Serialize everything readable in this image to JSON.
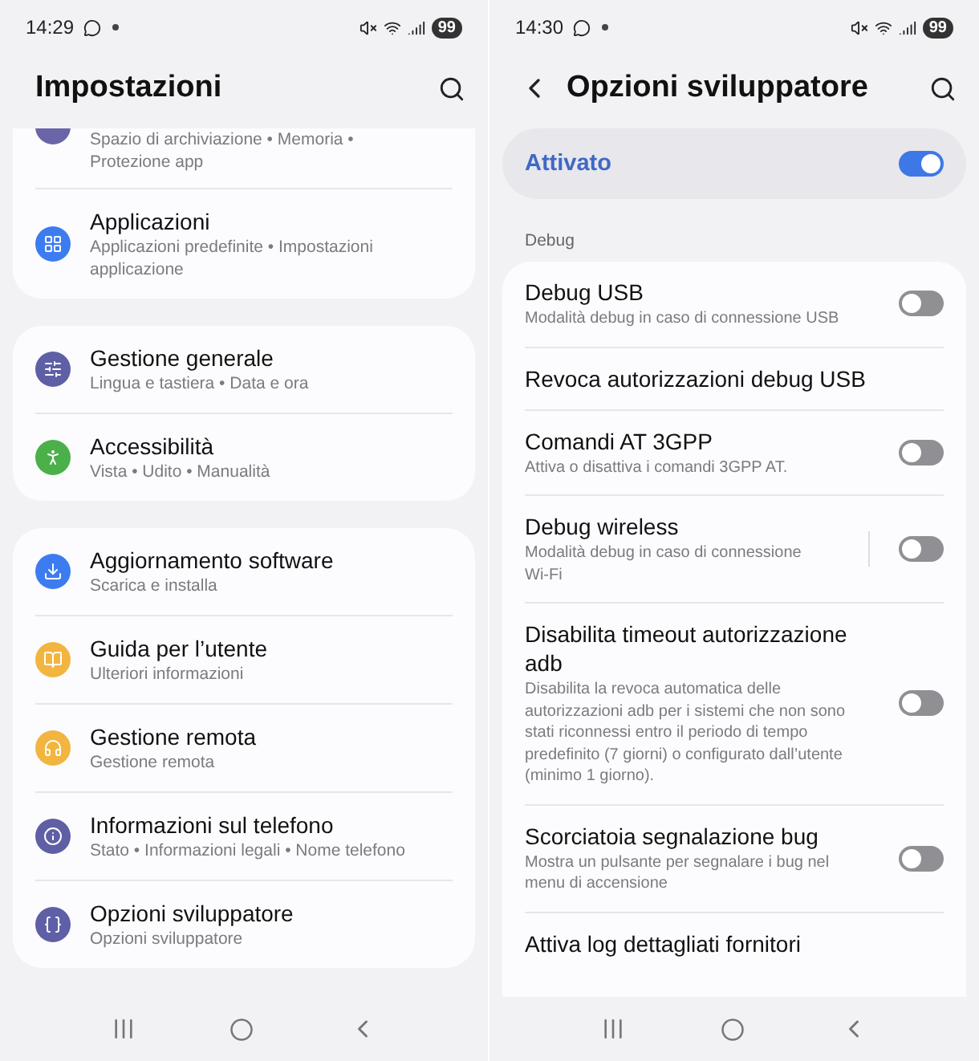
{
  "left": {
    "status_bar": {
      "time": "14:29",
      "battery": "99"
    },
    "title": "Impostazioni",
    "groups": [
      {
        "items": [
          {
            "subtitle": "Spazio di archiviazione • Memoria •",
            "subtitle2": "Protezione app",
            "color": "#6a64a8",
            "partial": true
          },
          {
            "title": "Applicazioni",
            "subtitle": "Applicazioni predefinite • Impostazioni applicazione",
            "color": "#3d7cf0"
          }
        ]
      },
      {
        "items": [
          {
            "title": "Gestione generale",
            "subtitle": "Lingua e tastiera • Data e ora",
            "color": "#5f5fa6"
          },
          {
            "title": "Accessibilità",
            "subtitle": "Vista • Udito • Manualità",
            "color": "#4bb04a"
          }
        ]
      },
      {
        "items": [
          {
            "title": "Aggiornamento software",
            "subtitle": "Scarica e installa",
            "color": "#3d7cf0"
          },
          {
            "title": "Guida per l’utente",
            "subtitle": "Ulteriori informazioni",
            "color": "#f2b540"
          },
          {
            "title": "Gestione remota",
            "subtitle": "Gestione remota",
            "color": "#f2b540"
          },
          {
            "title": "Informazioni sul telefono",
            "subtitle": "Stato • Informazioni legali • Nome telefono",
            "color": "#5f5fa6"
          },
          {
            "title": "Opzioni sviluppatore",
            "subtitle": "Opzioni sviluppatore",
            "color": "#5f5fa6"
          }
        ]
      }
    ]
  },
  "right": {
    "status_bar": {
      "time": "14:30",
      "battery": "99"
    },
    "title": "Opzioni sviluppatore",
    "master": {
      "label": "Attivato",
      "on": true
    },
    "section": "Debug",
    "rows": [
      {
        "kind": "toggle",
        "title": "Debug USB",
        "subtitle": "Modalità debug in caso di connessione USB",
        "on": false
      },
      {
        "kind": "link",
        "title": "Revoca autorizzazioni debug USB"
      },
      {
        "kind": "toggle",
        "title": "Comandi AT 3GPP",
        "subtitle": "Attiva o disattiva i comandi 3GPP AT.",
        "on": false
      },
      {
        "kind": "toggle",
        "title": "Debug wireless",
        "subtitle": "Modalità debug in caso di connessione Wi-Fi",
        "on": false,
        "split": true
      },
      {
        "kind": "toggle",
        "title": "Disabilita timeout autorizzazione adb",
        "subtitle": "Disabilita la revoca automatica delle autorizzazioni adb per i sistemi che non sono stati riconnessi entro il periodo di tempo predefinito (7 giorni) o configurato dall’utente (minimo 1 giorno).",
        "on": false
      },
      {
        "kind": "toggle",
        "title": "Scorciatoia segnalazione bug",
        "subtitle": "Mostra un pulsante per segnalare i bug nel menu di accensione",
        "on": false
      },
      {
        "kind": "link",
        "title": "Attiva log dettagliati fornitori"
      }
    ]
  }
}
